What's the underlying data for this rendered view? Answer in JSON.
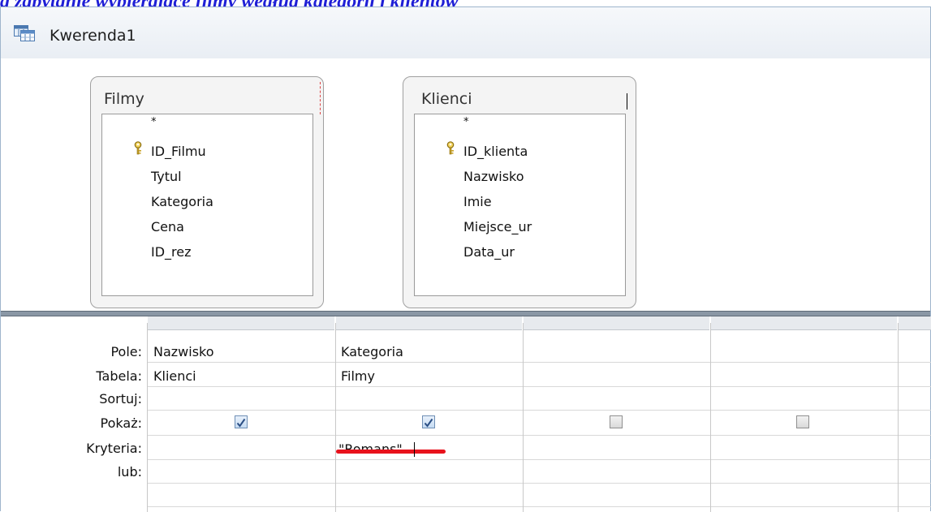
{
  "top_caption": "ą zapytanie wybierające filmy według kategorii i klientów",
  "window": {
    "title": "Kwerenda1"
  },
  "tables": [
    {
      "name": "Filmy",
      "fields": [
        {
          "label": "*",
          "key": false
        },
        {
          "label": "ID_Filmu",
          "key": true
        },
        {
          "label": "Tytul",
          "key": false
        },
        {
          "label": "Kategoria",
          "key": false
        },
        {
          "label": "Cena",
          "key": false
        },
        {
          "label": "ID_rez",
          "key": false
        }
      ]
    },
    {
      "name": "Klienci",
      "fields": [
        {
          "label": "*",
          "key": false
        },
        {
          "label": "ID_klienta",
          "key": true
        },
        {
          "label": "Nazwisko",
          "key": false
        },
        {
          "label": "Imie",
          "key": false
        },
        {
          "label": "Miejsce_ur",
          "key": false
        },
        {
          "label": "Data_ur",
          "key": false
        }
      ]
    }
  ],
  "grid": {
    "row_labels": {
      "field": "Pole:",
      "table": "Tabela:",
      "sort": "Sortuj:",
      "show": "Pokaż:",
      "criteria": "Kryteria:",
      "or": "lub:"
    },
    "columns": [
      {
        "field": "Nazwisko",
        "table": "Klienci",
        "sort": "",
        "show": true,
        "criteria": "",
        "or": ""
      },
      {
        "field": "Kategoria",
        "table": "Filmy",
        "sort": "",
        "show": true,
        "criteria": "\"Romans\"",
        "or": ""
      },
      {
        "field": "",
        "table": "",
        "sort": "",
        "show": false,
        "criteria": "",
        "or": ""
      },
      {
        "field": "",
        "table": "",
        "sort": "",
        "show": false,
        "criteria": "",
        "or": ""
      }
    ]
  },
  "colors": {
    "highlight_underline": "#e8121c",
    "caption_text": "#1f1fd6"
  }
}
